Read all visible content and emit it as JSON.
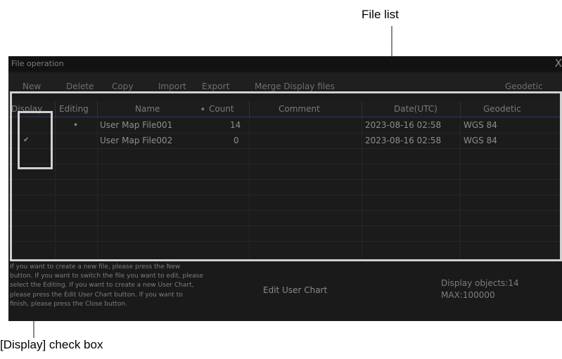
{
  "callouts": {
    "file_list": "File list",
    "display_checkbox": "[Display] check box"
  },
  "window": {
    "title": "File operation",
    "close_glyph": "X"
  },
  "toolbar": {
    "new": "New",
    "delete": "Delete",
    "copy": "Copy",
    "import": "Import",
    "export": "Export",
    "merge": "Merge Display files",
    "geodetic": "Geodetic"
  },
  "table": {
    "headers": {
      "display": "Display",
      "editing": "Editing",
      "name": "Name",
      "sort_mark": "▪",
      "count": "Count",
      "comment": "Comment",
      "date": "Date(UTC)",
      "geodetic": "Geodetic"
    },
    "rows": [
      {
        "display": "",
        "editing": "•",
        "name": "User Map File001",
        "count": "14",
        "comment": "",
        "date": "2023-08-16 02:58",
        "geodetic": "WGS 84"
      },
      {
        "display": "✔",
        "editing": "",
        "name": "User Map File002",
        "count": "0",
        "comment": "",
        "date": "2023-08-16 02:58",
        "geodetic": "WGS 84"
      }
    ]
  },
  "help_lines": [
    "If you want to create a new file, please press the New",
    "button. If you want to switch the file you want to edit, please",
    "select the Editing. If you want to create a new User Chart,",
    "please press the Edit User Chart button. If you want to",
    "finish, please press the Close button."
  ],
  "edit_user_chart_label": "Edit User Chart",
  "display_objects": "Display objects:14",
  "max_objects": "MAX:100000",
  "colors": {
    "background": "#1b1b1b",
    "text": "#8e8e8e",
    "header_line": "#233a66",
    "annotation": "#d0d0d0"
  }
}
